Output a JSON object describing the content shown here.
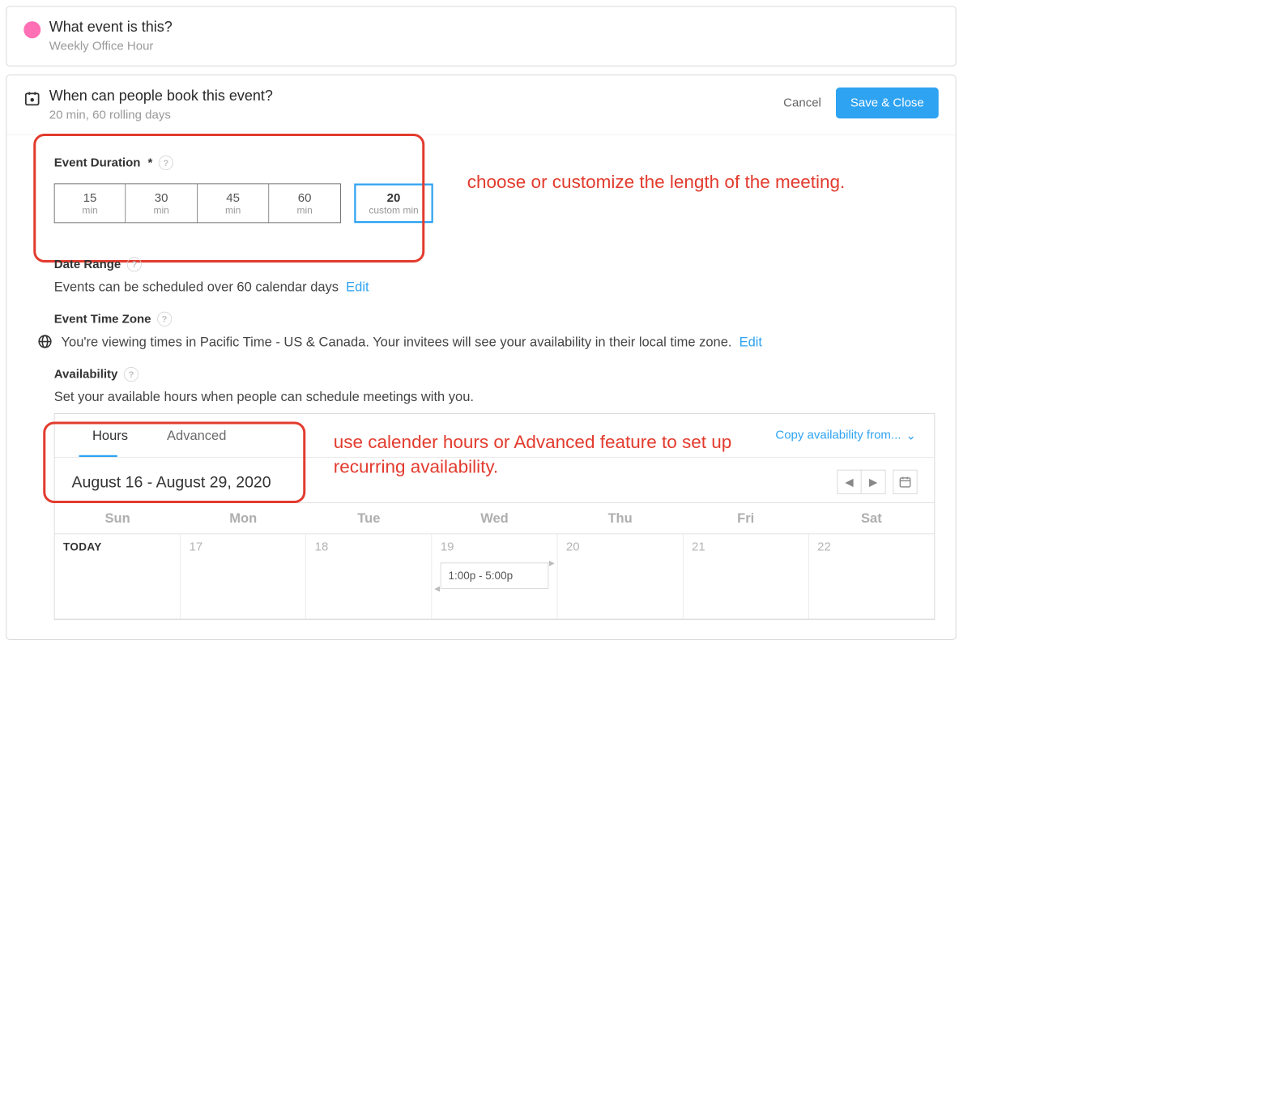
{
  "card1": {
    "title": "What event is this?",
    "subtitle": "Weekly Office Hour"
  },
  "card2": {
    "title": "When can people book this event?",
    "subtitle": "20 min, 60 rolling days",
    "cancel_label": "Cancel",
    "save_label": "Save & Close"
  },
  "duration": {
    "label": "Event Duration",
    "asterisk": "*",
    "help": "?",
    "options": [
      {
        "num": "15",
        "unit": "min"
      },
      {
        "num": "30",
        "unit": "min"
      },
      {
        "num": "45",
        "unit": "min"
      },
      {
        "num": "60",
        "unit": "min"
      }
    ],
    "custom": {
      "num": "20",
      "unit": "custom min"
    }
  },
  "annotations": {
    "a1": "choose or customize the length of the meeting.",
    "a2": "use calender hours or Advanced feature to set up recurring availability."
  },
  "daterange": {
    "label": "Date Range",
    "help": "?",
    "desc": "Events can be scheduled over 60 calendar days",
    "edit": "Edit"
  },
  "timezone": {
    "label": "Event Time Zone",
    "help": "?",
    "desc": "You're viewing times in Pacific Time - US & Canada. Your invitees will see your availability in their local time zone.",
    "edit": "Edit"
  },
  "availability": {
    "label": "Availability",
    "help": "?",
    "desc": "Set your available hours when people can schedule meetings with you.",
    "tabs": {
      "hours": "Hours",
      "advanced": "Advanced"
    },
    "copy_label": "Copy availability from...",
    "range": "August 16 - August 29, 2020",
    "weekdays": [
      "Sun",
      "Mon",
      "Tue",
      "Wed",
      "Thu",
      "Fri",
      "Sat"
    ],
    "row": {
      "today": "TODAY",
      "d1": "17",
      "d2": "18",
      "d3": "19",
      "d4": "20",
      "d5": "21",
      "d6": "22"
    },
    "event": "1:00p - 5:00p"
  },
  "nav": {
    "prev": "◀",
    "next": "▶"
  }
}
